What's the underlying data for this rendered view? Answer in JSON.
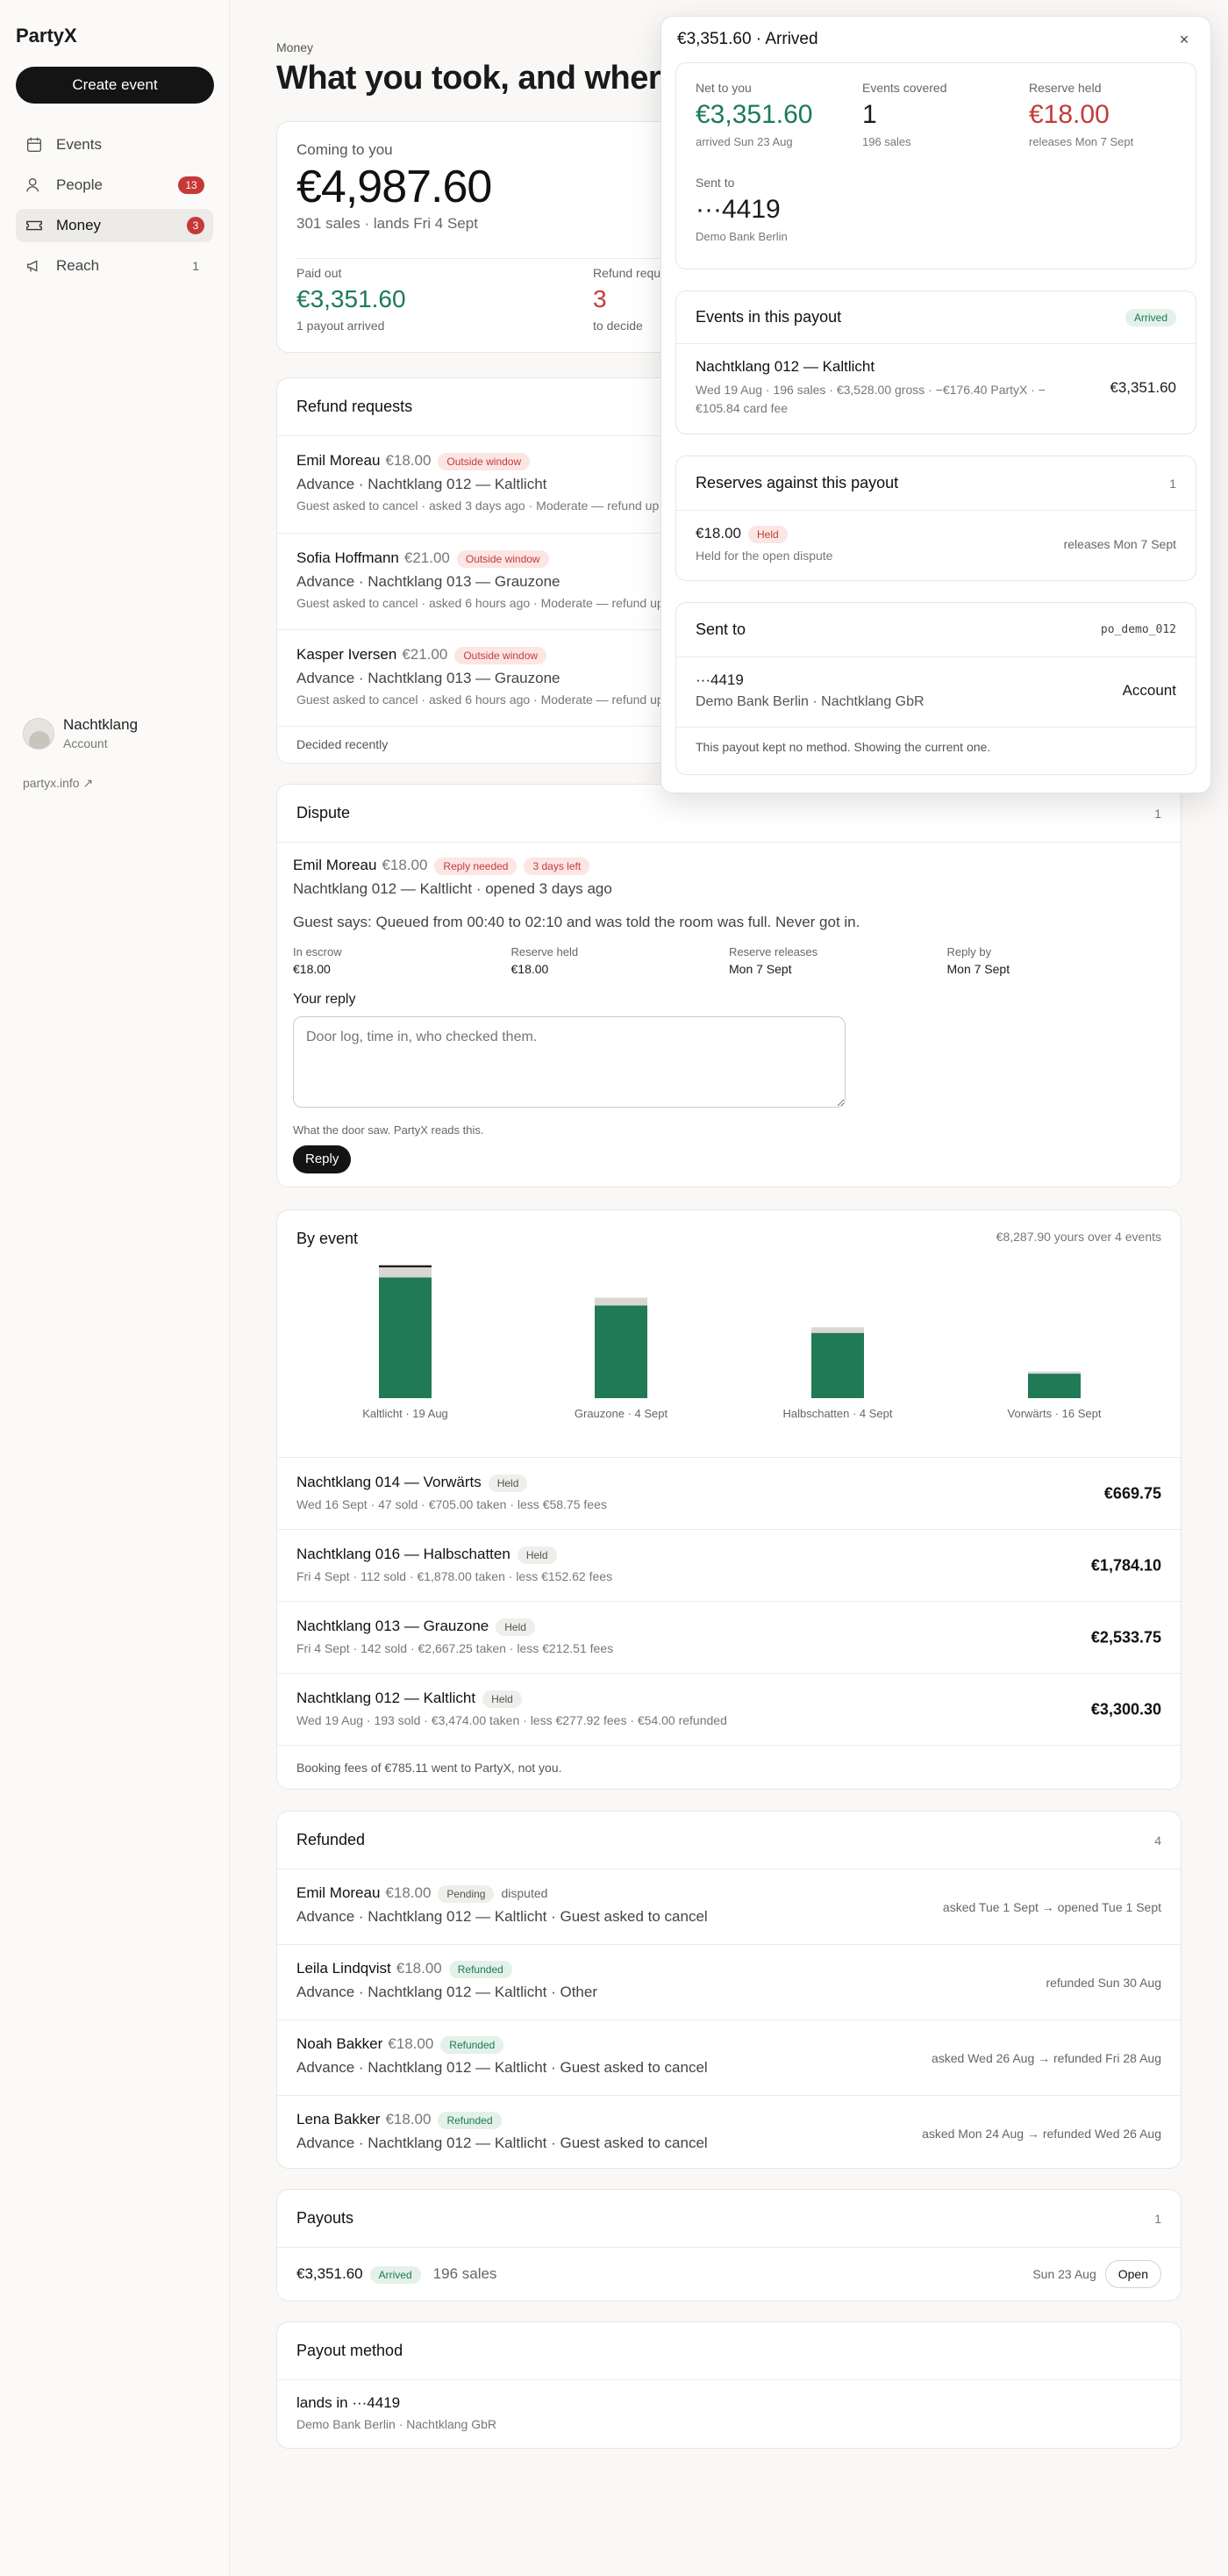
{
  "app": {
    "name": "PartyX"
  },
  "sidebar": {
    "create_label": "Create event",
    "items": [
      {
        "label": "Events",
        "badge": "",
        "count": ""
      },
      {
        "label": "People",
        "badge": "13",
        "count": ""
      },
      {
        "label": "Money",
        "badge": "3",
        "count": ""
      },
      {
        "label": "Reach",
        "badge": "",
        "count": "1"
      }
    ],
    "org_name": "Nachtklang",
    "org_sub": "Account",
    "link": "partyx.info"
  },
  "page": {
    "crumb": "Money",
    "title": "What you took, and where it went"
  },
  "summary": {
    "label": "Coming to you",
    "amount": "€4,987.60",
    "sub": "301 sales · lands Fri 4 Sept",
    "paid_label": "Paid out",
    "paid_amount": "€3,351.60",
    "paid_sub": "1 payout arrived",
    "refund_label": "Refund requests",
    "refund_value": "3",
    "refund_sub": "to decide"
  },
  "refund_requests": {
    "title": "Refund requests",
    "items": [
      {
        "name": "Emil Moreau",
        "amount": "€18.00",
        "tag": "Outside window",
        "sub": "Advance · Nachtklang 012 — Kaltlicht",
        "meta": "Guest asked to cancel · asked 3 days ago · Moderate — refund up to 50%"
      },
      {
        "name": "Sofia Hoffmann",
        "amount": "€21.00",
        "tag": "Outside window",
        "sub": "Advance · Nachtklang 013 — Grauzone",
        "meta": "Guest asked to cancel · asked 6 hours ago · Moderate — refund up to 50%"
      },
      {
        "name": "Kasper Iversen",
        "amount": "€21.00",
        "tag": "Outside window",
        "sub": "Advance · Nachtklang 013 — Grauzone",
        "meta": "Guest asked to cancel · asked 6 hours ago · Moderate — refund up to 50%"
      }
    ],
    "footer": "Decided recently"
  },
  "dispute": {
    "title": "Dispute",
    "count": "1",
    "name": "Emil Moreau",
    "amount": "€18.00",
    "tag1": "Reply needed",
    "tag2": "3 days left",
    "sub": "Nachtklang 012 — Kaltlicht · opened 3 days ago",
    "says": "Guest says: Queued from 00:40 to 02:10 and was told the room was full. Never got in.",
    "facts": [
      {
        "label": "In escrow",
        "value": "€18.00"
      },
      {
        "label": "Reserve held",
        "value": "€18.00"
      },
      {
        "label": "Reserve releases",
        "value": "Mon 7 Sept"
      },
      {
        "label": "Reply by",
        "value": "Mon 7 Sept"
      }
    ],
    "reply_label": "Your reply",
    "placeholder": "Door log, time in, who checked them.",
    "hint": "What the door saw. PartyX reads this.",
    "button": "Reply"
  },
  "by_event": {
    "title": "By event",
    "note": "€8,287.90 yours over 4 events",
    "rows": [
      {
        "name": "Nachtklang 014 — Vorwärts",
        "tag": "Held",
        "meta": "Wed 16 Sept · 47 sold · €705.00 taken · less €58.75 fees",
        "value": "€669.75"
      },
      {
        "name": "Nachtklang 016 — Halbschatten",
        "tag": "Held",
        "meta": "Fri 4 Sept · 112 sold · €1,878.00 taken · less €152.62 fees",
        "value": "€1,784.10"
      },
      {
        "name": "Nachtklang 013 — Grauzone",
        "tag": "Held",
        "meta": "Fri 4 Sept · 142 sold · €2,667.25 taken · less €212.51 fees",
        "value": "€2,533.75"
      },
      {
        "name": "Nachtklang 012 — Kaltlicht",
        "tag": "Held",
        "meta": "Wed 19 Aug · 193 sold · €3,474.00 taken · less €277.92 fees · €54.00 refunded",
        "value": "€3,300.30"
      }
    ],
    "footer": "Booking fees of €785.11 went to PartyX, not you."
  },
  "chart_data": {
    "type": "bar",
    "categories": [
      "Kaltlicht · 19 Aug",
      "Grauzone · 4 Sept",
      "Halbschatten · 4 Sept",
      "Vorwärts · 16 Sept"
    ],
    "series": [
      {
        "name": "",
        "values": [
          3300.3,
          2533.75,
          1784.1,
          669.75
        ]
      },
      {
        "name": "",
        "values": [
          277.92,
          212.51,
          152.62,
          58.75
        ]
      },
      {
        "name": "",
        "values": [
          54.0,
          0,
          0,
          0
        ]
      }
    ],
    "colors": [
      "#1f7a55",
      "#d9d7d2",
      "#141414"
    ],
    "stacked": true,
    "title": "",
    "xlabel": "",
    "ylabel": "",
    "ylim": [
      0,
      3600
    ]
  },
  "refunded": {
    "title": "Refunded",
    "count": "4",
    "items": [
      {
        "name": "Emil Moreau",
        "amount": "€18.00",
        "tag": "Pending",
        "extra": "disputed",
        "sub": "Advance · Nachtklang 012 — Kaltlicht · Guest asked to cancel",
        "right": "asked Tue 1 Sept → opened Tue 1 Sept"
      },
      {
        "name": "Leila Lindqvist",
        "amount": "€18.00",
        "tag": "Refunded",
        "extra": "",
        "sub": "Advance · Nachtklang 012 — Kaltlicht · Other",
        "right": "refunded Sun 30 Aug"
      },
      {
        "name": "Noah Bakker",
        "amount": "€18.00",
        "tag": "Refunded",
        "extra": "",
        "sub": "Advance · Nachtklang 012 — Kaltlicht · Guest asked to cancel",
        "right": "asked Wed 26 Aug → refunded Fri 28 Aug"
      },
      {
        "name": "Lena Bakker",
        "amount": "€18.00",
        "tag": "Refunded",
        "extra": "",
        "sub": "Advance · Nachtklang 012 — Kaltlicht · Guest asked to cancel",
        "right": "asked Mon 24 Aug → refunded Wed 26 Aug"
      }
    ]
  },
  "payouts": {
    "title": "Payouts",
    "count": "1",
    "amount": "€3,351.60",
    "tag": "Arrived",
    "sales": "196 sales",
    "date": "Sun 23 Aug",
    "open": "Open"
  },
  "payout_method": {
    "title": "Payout method",
    "value": "lands in ···4419",
    "sub": "Demo Bank Berlin · Nachtklang GbR"
  },
  "panel": {
    "title": "€3,351.60 · Arrived",
    "close": "×",
    "net_label": "Net to you",
    "net_value": "€3,351.60",
    "net_sub": "arrived Sun 23 Aug",
    "events_label": "Events covered",
    "events_value": "1",
    "events_sub": "196 sales",
    "reserve_label": "Reserve held",
    "reserve_value": "€18.00",
    "reserve_sub": "releases Mon 7 Sept",
    "sent_label": "Sent to",
    "sent_value": "···4419",
    "sent_sub": "Demo Bank Berlin",
    "events_title": "Events in this payout",
    "events_tag": "Arrived",
    "ev_name": "Nachtklang 012 — Kaltlicht",
    "ev_meta": "Wed 19 Aug · 196 sales · €3,528.00 gross · −€176.40 PartyX · −€105.84 card fee",
    "ev_value": "€3,351.60",
    "res_title": "Reserves against this payout",
    "res_count": "1",
    "res_amount": "€18.00",
    "res_tag": "Held",
    "res_sub": "Held for the open dispute",
    "res_right": "releases Mon 7 Sept",
    "st_title": "Sent to",
    "st_id": "po_demo_012",
    "st_acct": "···4419",
    "st_sub": "Demo Bank Berlin · Nachtklang GbR",
    "st_right": "Account",
    "st_note": "This payout kept no method. Showing the current one."
  }
}
